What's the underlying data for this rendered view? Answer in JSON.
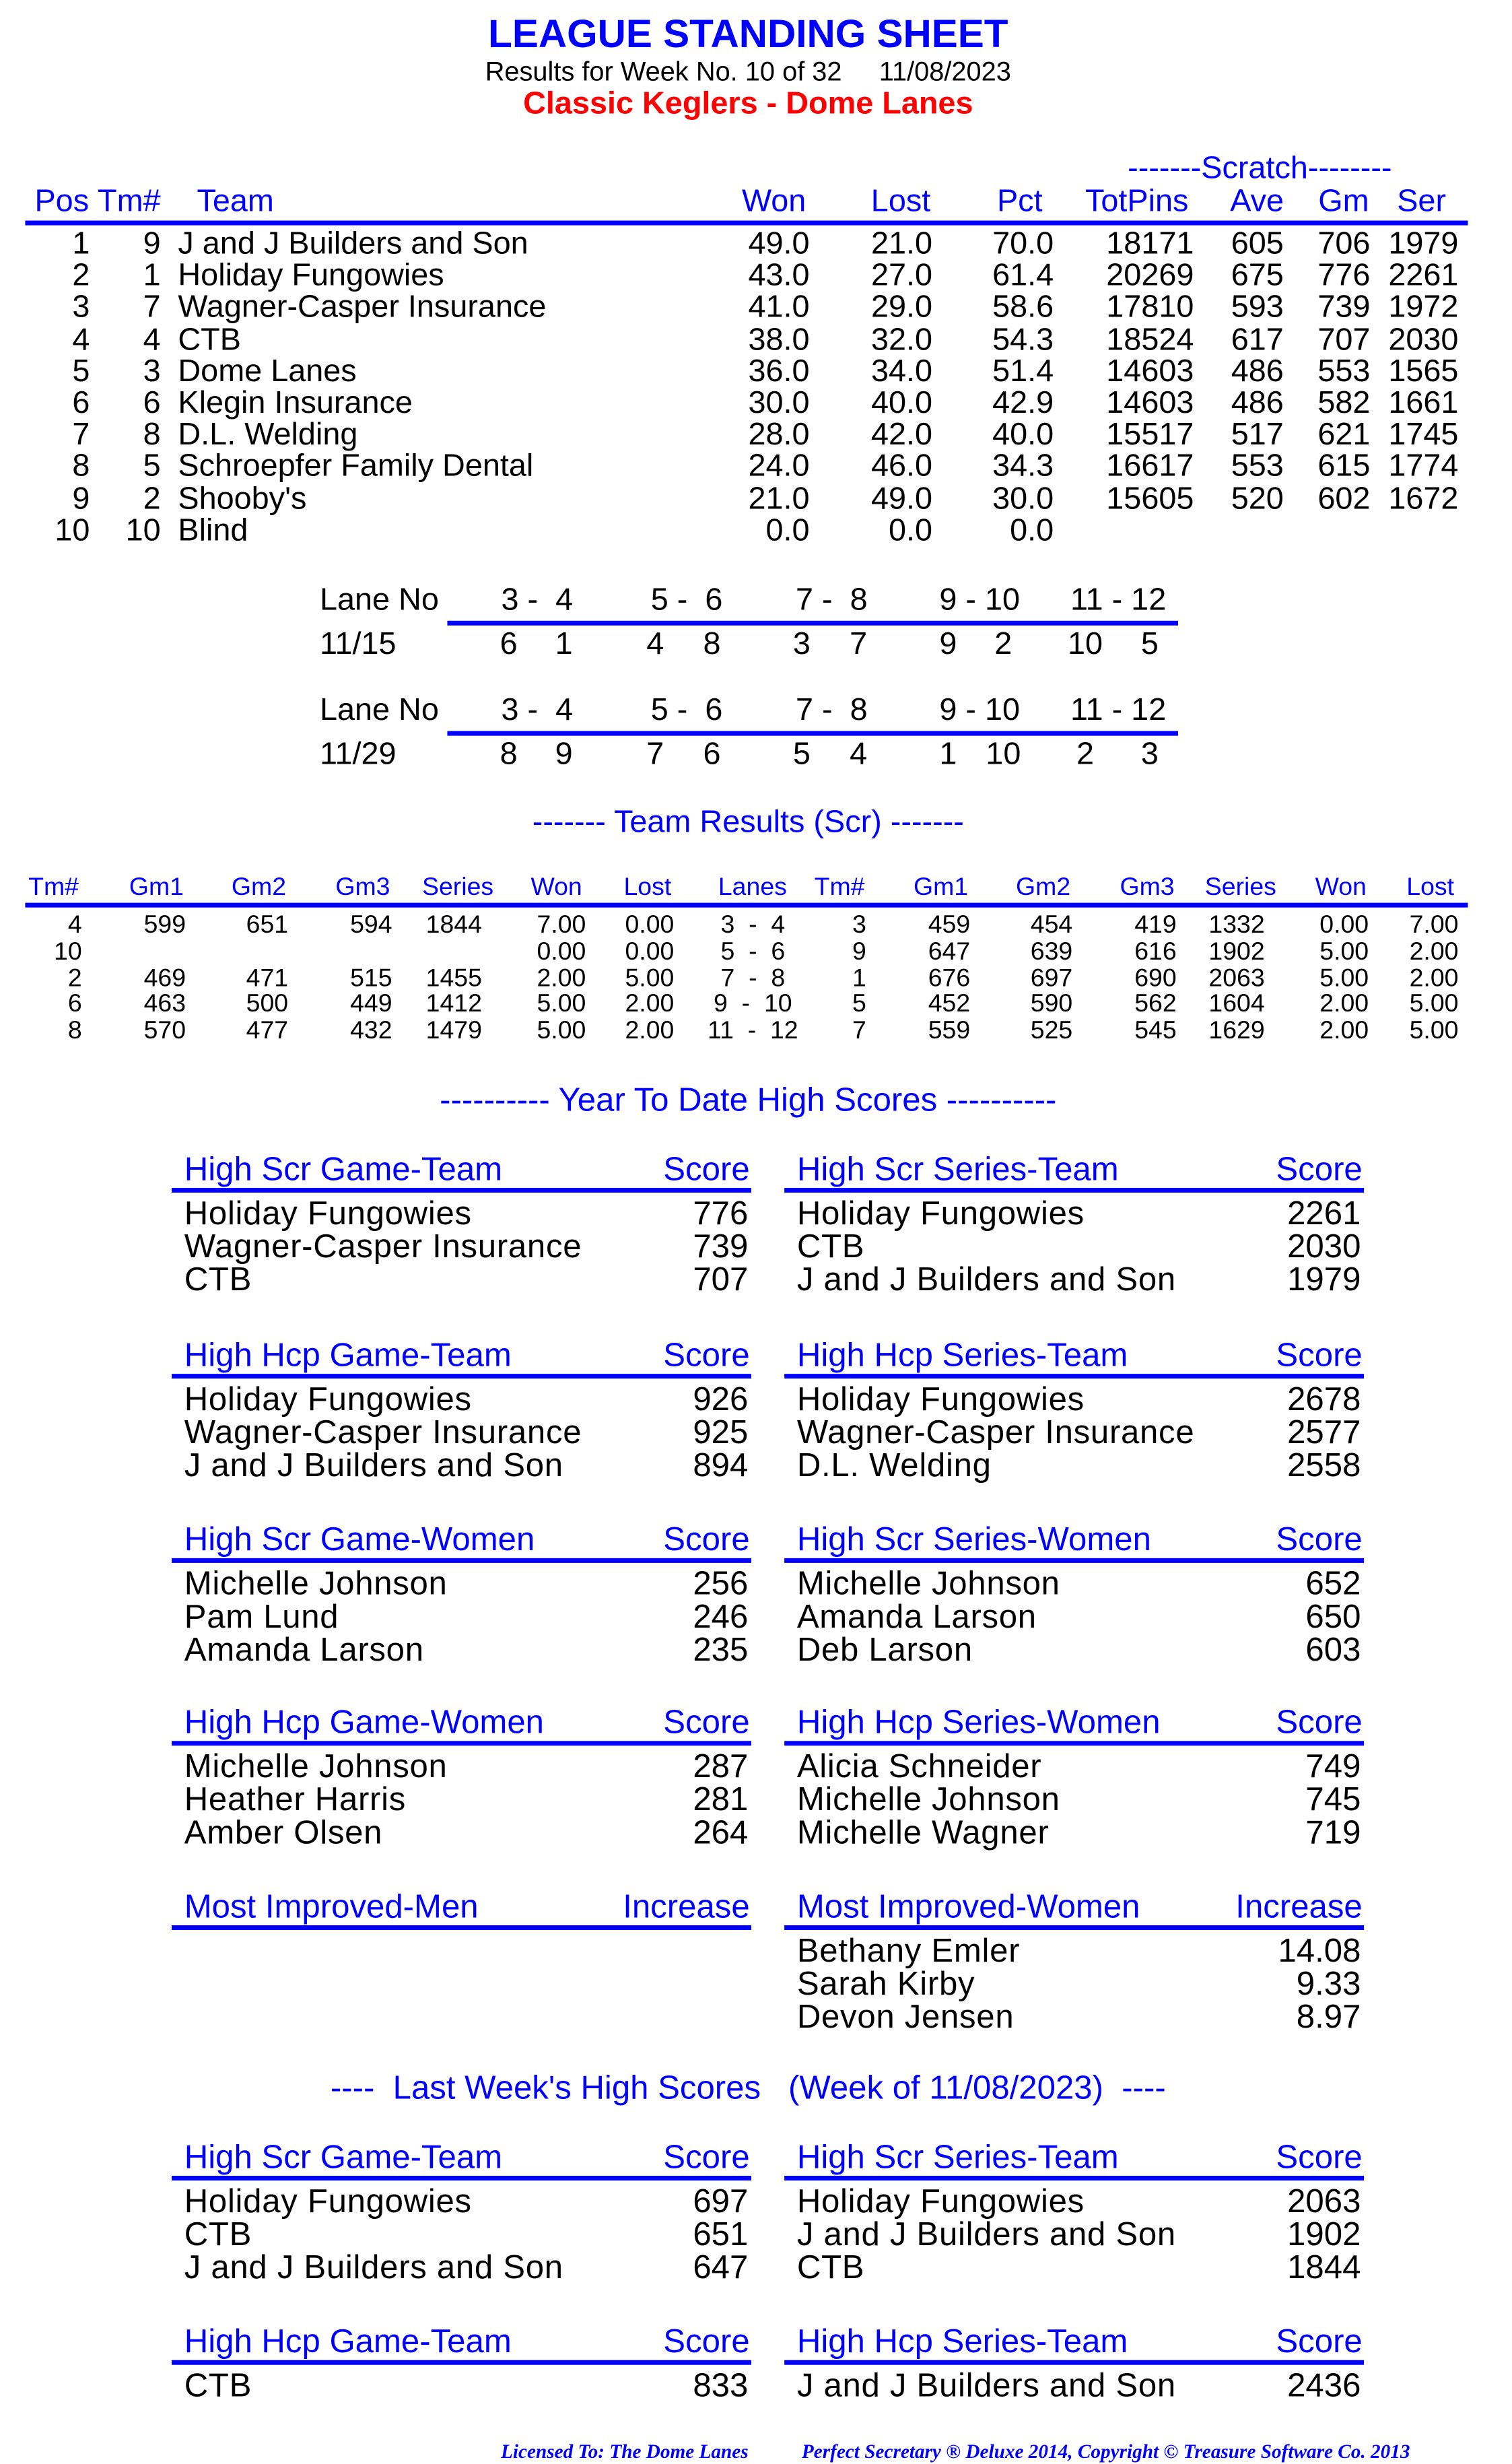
{
  "header": {
    "title": "LEAGUE STANDING SHEET",
    "subtitle": "Results for Week No. 10 of 32     11/08/2023",
    "league": "Classic Keglers - Dome Lanes"
  },
  "colors": {
    "accent": "#0000ff",
    "league": "#ff0000"
  },
  "standings": {
    "group_label": "-------Scratch--------",
    "columns": [
      "Pos",
      "Tm#",
      "Team",
      "Won",
      "Lost",
      "Pct",
      "TotPins",
      "Ave",
      "Gm",
      "Ser"
    ],
    "rows": [
      [
        "1",
        "9",
        "J and J Builders and Son",
        "49.0",
        "21.0",
        "70.0",
        "18171",
        "605",
        "706",
        "1979"
      ],
      [
        "2",
        "1",
        "Holiday Fungowies",
        "43.0",
        "27.0",
        "61.4",
        "20269",
        "675",
        "776",
        "2261"
      ],
      [
        "3",
        "7",
        "Wagner-Casper Insurance",
        "41.0",
        "29.0",
        "58.6",
        "17810",
        "593",
        "739",
        "1972"
      ],
      [
        "4",
        "4",
        "CTB",
        "38.0",
        "32.0",
        "54.3",
        "18524",
        "617",
        "707",
        "2030"
      ],
      [
        "5",
        "3",
        "Dome Lanes",
        "36.0",
        "34.0",
        "51.4",
        "14603",
        "486",
        "553",
        "1565"
      ],
      [
        "6",
        "6",
        "Klegin Insurance",
        "30.0",
        "40.0",
        "42.9",
        "14603",
        "486",
        "582",
        "1661"
      ],
      [
        "7",
        "8",
        "D.L. Welding",
        "28.0",
        "42.0",
        "40.0",
        "15517",
        "517",
        "621",
        "1745"
      ],
      [
        "8",
        "5",
        "Schroepfer Family Dental",
        "24.0",
        "46.0",
        "34.3",
        "16617",
        "553",
        "615",
        "1774"
      ],
      [
        "9",
        "2",
        "Shooby's",
        "21.0",
        "49.0",
        "30.0",
        "15605",
        "520",
        "602",
        "1672"
      ],
      [
        "10",
        "10",
        "Blind",
        "0.0",
        "0.0",
        "0.0",
        "",
        "",
        "",
        ""
      ]
    ]
  },
  "lane_schedule": [
    {
      "label": "Lane No",
      "lanes": [
        "3 -  4",
        "5 -  6",
        "7 -  8",
        "9 - 10",
        "11 - 12"
      ],
      "date": "11/15",
      "pairs": [
        [
          "6",
          "1"
        ],
        [
          "4",
          "8"
        ],
        [
          "3",
          "7"
        ],
        [
          "9",
          "2"
        ],
        [
          "10",
          "5"
        ]
      ]
    },
    {
      "label": "Lane No",
      "lanes": [
        "3 -  4",
        "5 -  6",
        "7 -  8",
        "9 - 10",
        "11 - 12"
      ],
      "date": "11/29",
      "pairs": [
        [
          "8",
          "9"
        ],
        [
          "7",
          "6"
        ],
        [
          "5",
          "4"
        ],
        [
          "1",
          "10"
        ],
        [
          "2",
          "3"
        ]
      ]
    }
  ],
  "team_results": {
    "title": "------- Team Results (Scr) -------",
    "columns": [
      "Tm#",
      "Gm1",
      "Gm2",
      "Gm3",
      "Series",
      "Won",
      "Lost",
      "Lanes",
      "Tm#",
      "Gm1",
      "Gm2",
      "Gm3",
      "Series",
      "Won",
      "Lost"
    ],
    "rows": [
      [
        "4",
        "599",
        "651",
        "594",
        "1844",
        "7.00",
        "0.00",
        "3  -  4",
        "3",
        "459",
        "454",
        "419",
        "1332",
        "0.00",
        "7.00"
      ],
      [
        "10",
        "",
        "",
        "",
        "",
        "0.00",
        "0.00",
        "5  -  6",
        "9",
        "647",
        "639",
        "616",
        "1902",
        "5.00",
        "2.00"
      ],
      [
        "2",
        "469",
        "471",
        "515",
        "1455",
        "2.00",
        "5.00",
        "7  -  8",
        "1",
        "676",
        "697",
        "690",
        "2063",
        "5.00",
        "2.00"
      ],
      [
        "6",
        "463",
        "500",
        "449",
        "1412",
        "5.00",
        "2.00",
        "9  -  10",
        "5",
        "452",
        "590",
        "562",
        "1604",
        "2.00",
        "5.00"
      ],
      [
        "8",
        "570",
        "477",
        "432",
        "1479",
        "5.00",
        "2.00",
        "11  -  12",
        "7",
        "559",
        "525",
        "545",
        "1629",
        "2.00",
        "5.00"
      ]
    ]
  },
  "ytd": {
    "title": "---------- Year To Date High Scores ----------",
    "sections": [
      {
        "left": {
          "title": "High Scr Game-Team",
          "col": "Score",
          "entries": [
            [
              "Holiday Fungowies",
              "776"
            ],
            [
              "Wagner-Casper Insurance",
              "739"
            ],
            [
              "CTB",
              "707"
            ]
          ]
        },
        "right": {
          "title": "High Scr Series-Team",
          "col": "Score",
          "entries": [
            [
              "Holiday Fungowies",
              "2261"
            ],
            [
              "CTB",
              "2030"
            ],
            [
              "J and J Builders and Son",
              "1979"
            ]
          ]
        }
      },
      {
        "left": {
          "title": "High Hcp Game-Team",
          "col": "Score",
          "entries": [
            [
              "Holiday Fungowies",
              "926"
            ],
            [
              "Wagner-Casper Insurance",
              "925"
            ],
            [
              "J and J Builders and Son",
              "894"
            ]
          ]
        },
        "right": {
          "title": "High Hcp Series-Team",
          "col": "Score",
          "entries": [
            [
              "Holiday Fungowies",
              "2678"
            ],
            [
              "Wagner-Casper Insurance",
              "2577"
            ],
            [
              "D.L. Welding",
              "2558"
            ]
          ]
        }
      },
      {
        "left": {
          "title": "High Scr Game-Women",
          "col": "Score",
          "entries": [
            [
              "Michelle Johnson",
              "256"
            ],
            [
              "Pam Lund",
              "246"
            ],
            [
              "Amanda Larson",
              "235"
            ]
          ]
        },
        "right": {
          "title": "High Scr Series-Women",
          "col": "Score",
          "entries": [
            [
              "Michelle Johnson",
              "652"
            ],
            [
              "Amanda Larson",
              "650"
            ],
            [
              "Deb Larson",
              "603"
            ]
          ]
        }
      },
      {
        "left": {
          "title": "High Hcp Game-Women",
          "col": "Score",
          "entries": [
            [
              "Michelle Johnson",
              "287"
            ],
            [
              "Heather Harris",
              "281"
            ],
            [
              "Amber Olsen",
              "264"
            ]
          ]
        },
        "right": {
          "title": "High Hcp Series-Women",
          "col": "Score",
          "entries": [
            [
              "Alicia Schneider",
              "749"
            ],
            [
              "Michelle Johnson",
              "745"
            ],
            [
              "Michelle Wagner",
              "719"
            ]
          ]
        }
      },
      {
        "left": {
          "title": "Most Improved-Men",
          "col": "Increase",
          "entries": []
        },
        "right": {
          "title": "Most Improved-Women",
          "col": "Increase",
          "entries": [
            [
              "Bethany Emler",
              "14.08"
            ],
            [
              "Sarah Kirby",
              "9.33"
            ],
            [
              "Devon Jensen",
              "8.97"
            ]
          ]
        }
      }
    ]
  },
  "last_week": {
    "title": "----  Last Week's High Scores   (Week of 11/08/2023)  ----",
    "sections": [
      {
        "left": {
          "title": "High Scr Game-Team",
          "col": "Score",
          "entries": [
            [
              "Holiday Fungowies",
              "697"
            ],
            [
              "CTB",
              "651"
            ],
            [
              "J and J Builders and Son",
              "647"
            ]
          ]
        },
        "right": {
          "title": "High Scr Series-Team",
          "col": "Score",
          "entries": [
            [
              "Holiday Fungowies",
              "2063"
            ],
            [
              "J and J Builders and Son",
              "1902"
            ],
            [
              "CTB",
              "1844"
            ]
          ]
        }
      },
      {
        "left": {
          "title": "High Hcp Game-Team",
          "col": "Score",
          "entries": [
            [
              "CTB",
              "833"
            ]
          ]
        },
        "right": {
          "title": "High Hcp Series-Team",
          "col": "Score",
          "entries": [
            [
              "J and J Builders and Son",
              "2436"
            ]
          ]
        }
      }
    ]
  },
  "footer": {
    "license": "Licensed To: The Dome Lanes",
    "product": "Perfect Secretary ® Deluxe  2014, Copyright © Treasure Software Co. 2013"
  }
}
